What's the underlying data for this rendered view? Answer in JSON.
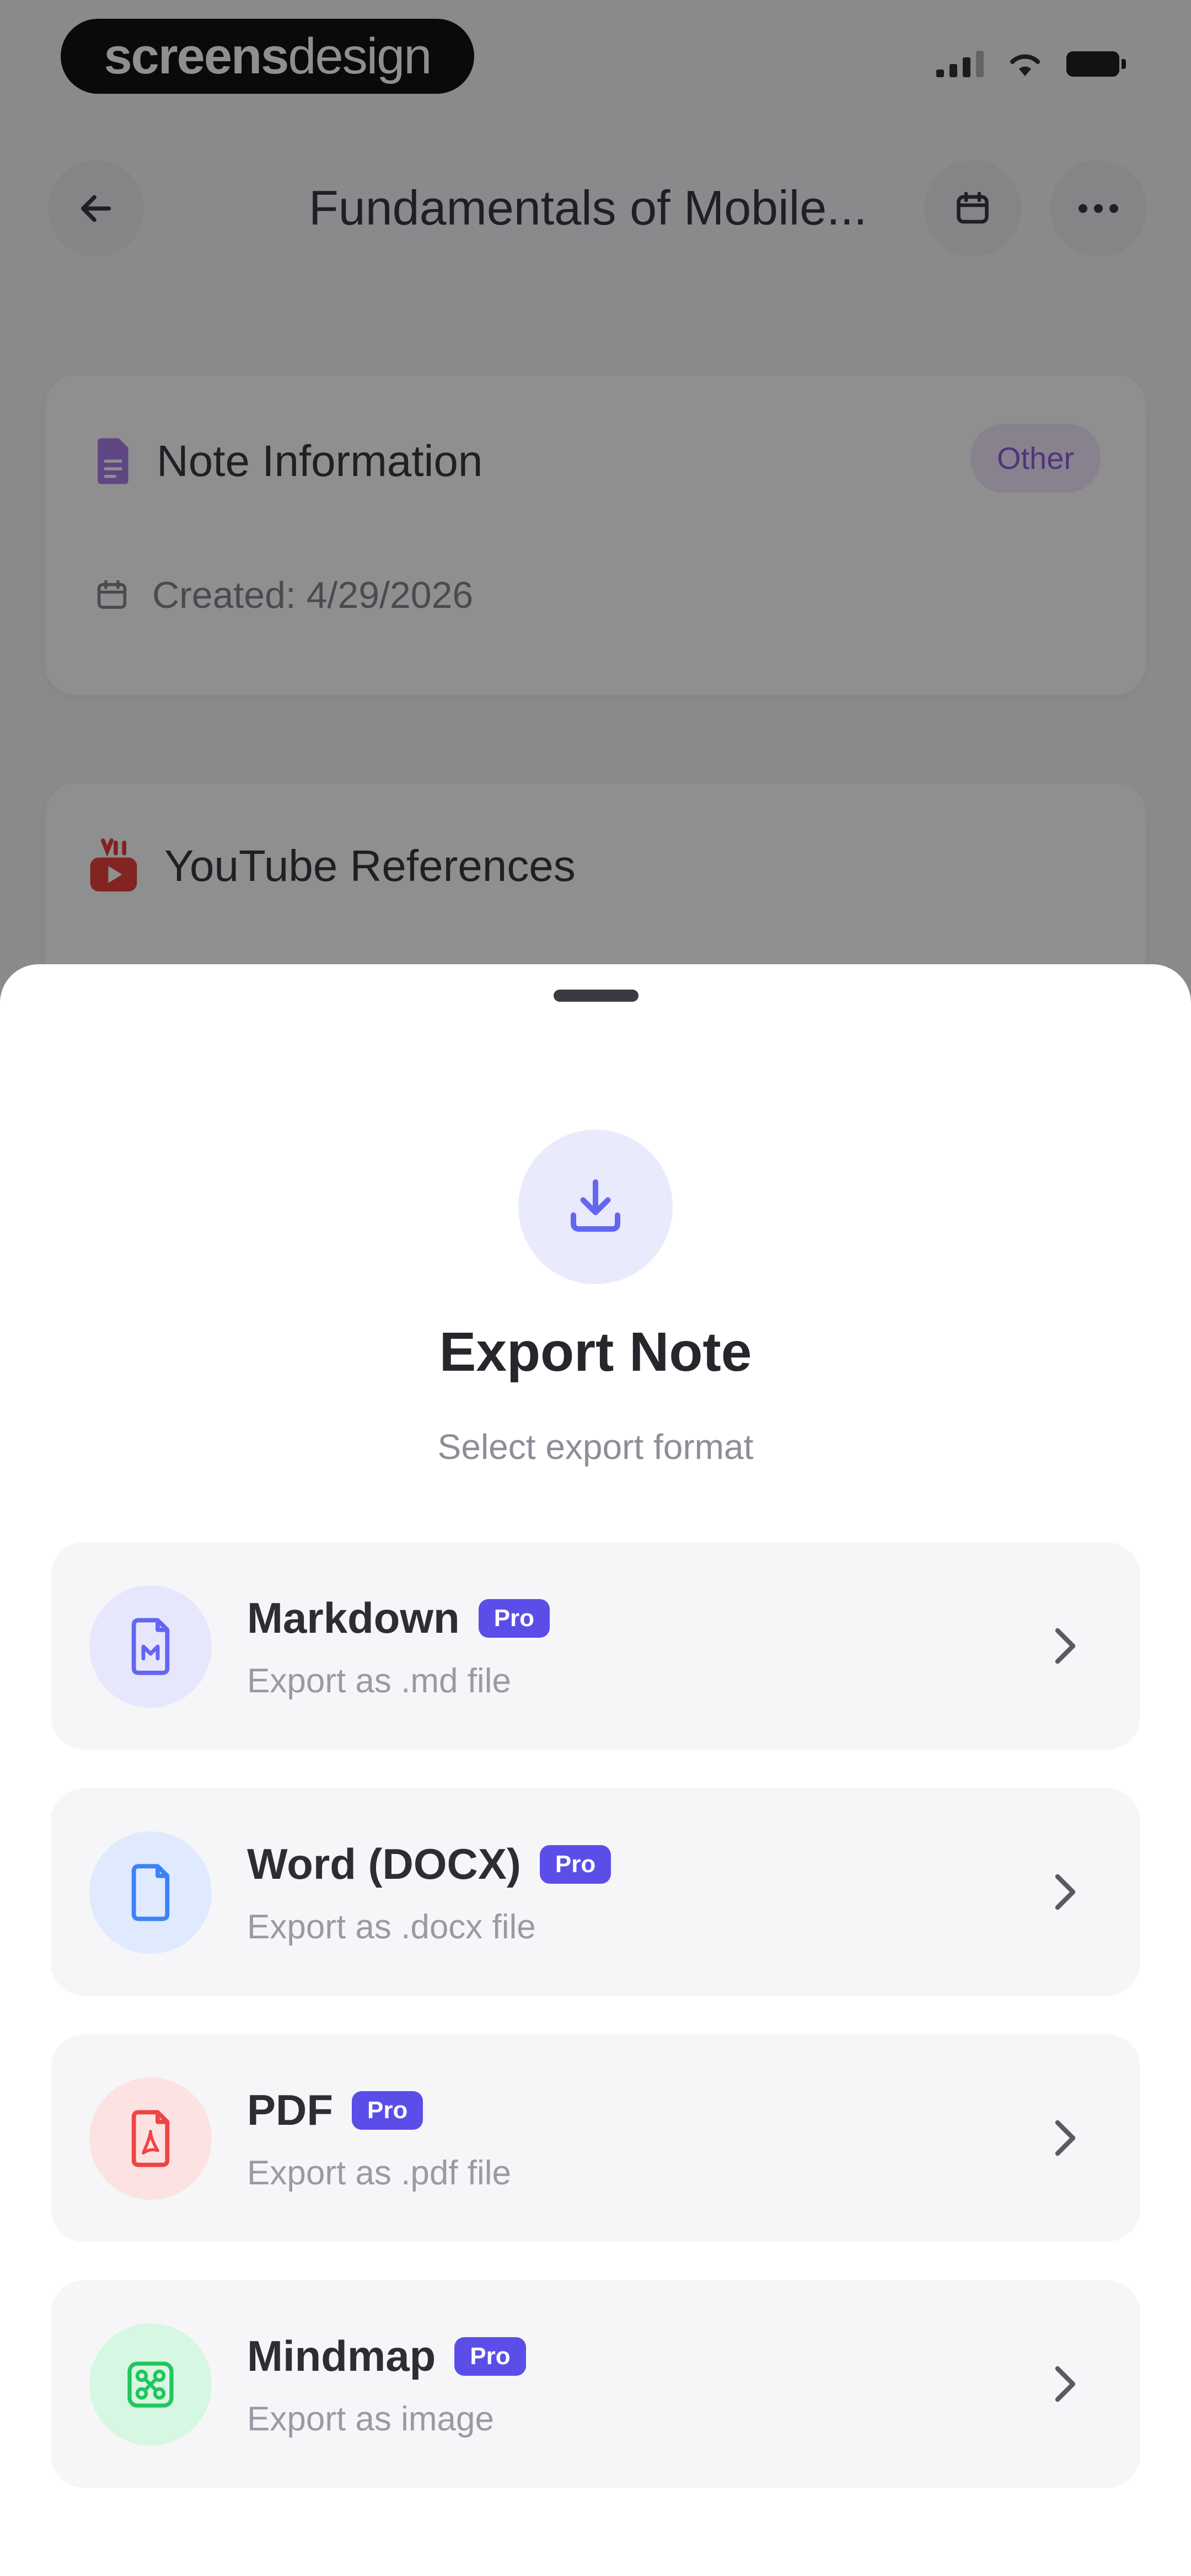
{
  "status_bar": {
    "brand_bold": "screens",
    "brand_thin": "design"
  },
  "nav": {
    "back_icon": "arrow-left-icon",
    "title": "Fundamentals of Mobile...",
    "calendar_icon": "calendar-icon",
    "more_icon": "more-horizontal-icon"
  },
  "note_info": {
    "heading": "Note Information",
    "category_badge": "Other",
    "created_label": "Created: 4/29/2026"
  },
  "youtube": {
    "heading": "YouTube References"
  },
  "export_sheet": {
    "icon": "download-icon",
    "title": "Export Note",
    "subtitle": "Select export format",
    "options": [
      {
        "title": "Markdown",
        "badge": "Pro",
        "subtitle": "Export as .md file",
        "icon": "markdown-file-icon",
        "color": "#6366f1",
        "bg": "#e6e7fd"
      },
      {
        "title": "Word (DOCX)",
        "badge": "Pro",
        "subtitle": "Export as .docx file",
        "icon": "word-file-icon",
        "color": "#3b82f6",
        "bg": "#dfeafe"
      },
      {
        "title": "PDF",
        "badge": "Pro",
        "subtitle": "Export as .pdf file",
        "icon": "pdf-file-icon",
        "color": "#ef4444",
        "bg": "#fde2e2"
      },
      {
        "title": "Mindmap",
        "badge": "Pro",
        "subtitle": "Export as image",
        "icon": "mindmap-icon",
        "color": "#22c55e",
        "bg": "#d6f7e1"
      }
    ]
  },
  "colors": {
    "accent": "#5b4ee8",
    "overlay": "rgba(20,20,24,0.48)"
  }
}
